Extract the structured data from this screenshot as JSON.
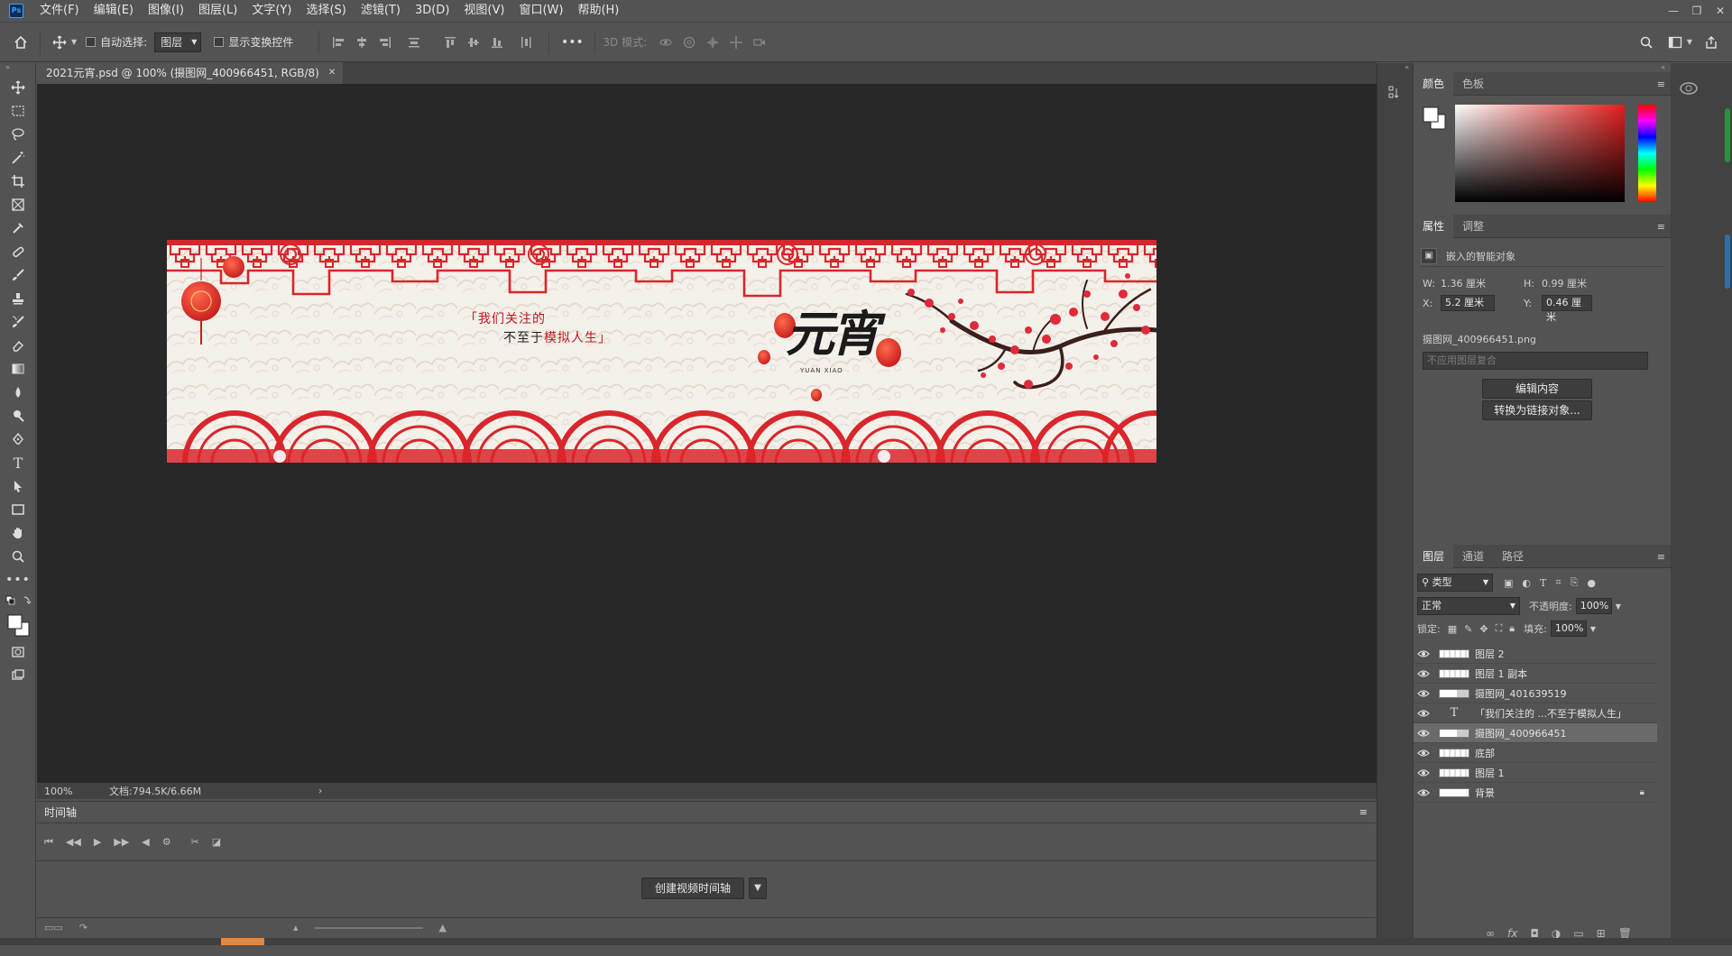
{
  "app": {
    "icon_label": "Ps"
  },
  "menu": [
    "文件(F)",
    "编辑(E)",
    "图像(I)",
    "图层(L)",
    "文字(Y)",
    "选择(S)",
    "滤镜(T)",
    "3D(D)",
    "视图(V)",
    "窗口(W)",
    "帮助(H)"
  ],
  "options": {
    "auto_select_label": "自动选择:",
    "auto_select_value": "图层",
    "show_transform_label": "显示变换控件",
    "mode_3d_label": "3D 模式:"
  },
  "document": {
    "tab_title": "2021元宵.psd @ 100% (摄图网_400966451, RGB/8)",
    "zoom": "100%",
    "doc_info": "文档:794.5K/6.66M"
  },
  "banner": {
    "quote_line1": "「我们关注的",
    "quote_line2_a": "不至于",
    "quote_line2_b": "模拟人生」",
    "title": "元宵",
    "subtitle": "YUAN XIAO"
  },
  "timeline": {
    "title": "时间轴",
    "create_button": "创建视频时间轴"
  },
  "color_panel": {
    "tabs": [
      "颜色",
      "色板"
    ]
  },
  "properties_panel": {
    "tabs": [
      "属性",
      "调整"
    ],
    "object_type": "嵌入的智能对象",
    "w_label": "W:",
    "w_value": "1.36 厘米",
    "h_label": "H:",
    "h_value": "0.99 厘米",
    "x_label": "X:",
    "x_value": "5.2 厘米",
    "y_label": "Y:",
    "y_value": "0.46 厘米",
    "file_name": "摄图网_400966451.png",
    "comp_placeholder": "不应用图层复合",
    "edit_button": "编辑内容",
    "convert_button": "转换为链接对象..."
  },
  "layers_panel": {
    "tabs": [
      "图层",
      "通道",
      "路径"
    ],
    "filter_value": "类型",
    "blend_mode": "正常",
    "opacity_label": "不透明度:",
    "opacity_value": "100%",
    "lock_label": "锁定:",
    "fill_label": "填充:",
    "fill_value": "100%",
    "layers": [
      {
        "name": "图层 2",
        "kind": "pixel",
        "selected": false
      },
      {
        "name": "图层 1 副本",
        "kind": "pixel",
        "selected": false
      },
      {
        "name": "摄图网_401639519",
        "kind": "smart",
        "selected": false
      },
      {
        "name": "「我们关注的    ...不至于模拟人生」",
        "kind": "text",
        "selected": false
      },
      {
        "name": "摄图网_400966451",
        "kind": "smart",
        "selected": true
      },
      {
        "name": "底部",
        "kind": "pixel",
        "selected": false
      },
      {
        "name": "图层 1",
        "kind": "pixel",
        "selected": false
      },
      {
        "name": "背景",
        "kind": "background",
        "selected": false
      }
    ]
  },
  "colors": {
    "accent_red": "#d9262c",
    "chrome": "#535353",
    "canvas_bg": "#282828"
  }
}
